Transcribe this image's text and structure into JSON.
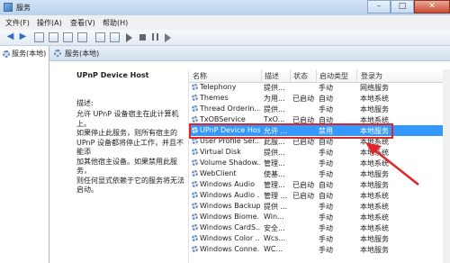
{
  "window": {
    "title": "服务",
    "buttons": [
      "–",
      "□",
      "✕"
    ]
  },
  "menu": [
    "文件(F)",
    "操作(A)",
    "查看(V)",
    "帮助(H)"
  ],
  "tree": {
    "root_label": "服务(本地)"
  },
  "pane": {
    "header": "服务(本地)"
  },
  "selected_service": {
    "name": "UPnP Device Host",
    "description_label": "描述:",
    "description": "允许 UPnP 设备宿主在此计算机上。\n如果停止此服务，则所有宿主的\nUPnP 设备都将停止工作，并且不能添\n加其他宿主设备。如果禁用此服务，\n则任何显式依赖于它的服务将无法\n启动。"
  },
  "columns": [
    "名称",
    "描述",
    "状态",
    "启动类型",
    "登录为"
  ],
  "services": [
    {
      "name": "Telephony",
      "desc": "提供...",
      "status": "",
      "startup": "手动",
      "logon": "网络服务"
    },
    {
      "name": "Themes",
      "desc": "为用...",
      "status": "已启动",
      "startup": "自动",
      "logon": "本地系统"
    },
    {
      "name": "Thread Orderin...",
      "desc": "提供...",
      "status": "",
      "startup": "手动",
      "logon": "本地服务"
    },
    {
      "name": "TxOBService",
      "desc": "TxO...",
      "status": "已启动",
      "startup": "自动",
      "logon": "本地系统"
    },
    {
      "name": "UPnP Device Host",
      "desc": "允许 ...",
      "status": "",
      "startup": "禁用",
      "logon": "本地服务"
    },
    {
      "name": "User Profile Ser...",
      "desc": "此服...",
      "status": "已启动",
      "startup": "自动",
      "logon": "本地系统"
    },
    {
      "name": "Virtual Disk",
      "desc": "提供...",
      "status": "",
      "startup": "手动",
      "logon": "本地系统"
    },
    {
      "name": "Volume Shadow...",
      "desc": "管理...",
      "status": "",
      "startup": "手动",
      "logon": "本地系统"
    },
    {
      "name": "WebClient",
      "desc": "使基...",
      "status": "",
      "startup": "手动",
      "logon": "本地服务"
    },
    {
      "name": "Windows Audio",
      "desc": "管理...",
      "status": "已启动",
      "startup": "自动",
      "logon": "本地服务"
    },
    {
      "name": "Windows Audio ...",
      "desc": "管理 ...",
      "status": "已启动",
      "startup": "自动",
      "logon": "本地系统"
    },
    {
      "name": "Windows Backup",
      "desc": "提供 ...",
      "status": "",
      "startup": "手动",
      "logon": "本地系统"
    },
    {
      "name": "Windows Biome...",
      "desc": "Win...",
      "status": "",
      "startup": "手动",
      "logon": "本地系统"
    },
    {
      "name": "Windows CardS...",
      "desc": "安全...",
      "status": "",
      "startup": "手动",
      "logon": "本地系统"
    },
    {
      "name": "Windows Color ...",
      "desc": "Wcs...",
      "status": "",
      "startup": "手动",
      "logon": "本地服务"
    },
    {
      "name": "Windows Conne...",
      "desc": "WC...",
      "status": "",
      "startup": "手动",
      "logon": "本地服务"
    }
  ],
  "selected_index": 4,
  "accent_color": "#3399ff",
  "highlight_color": "#e0242a"
}
